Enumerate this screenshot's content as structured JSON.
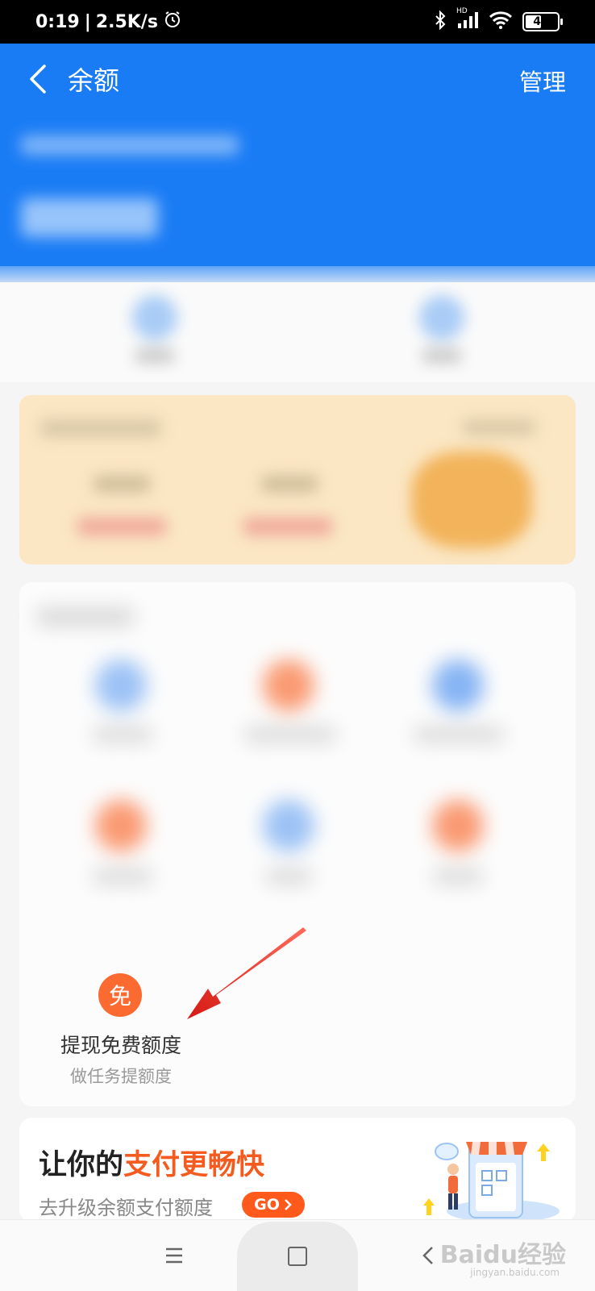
{
  "status_bar": {
    "time": "0:19",
    "separator": "|",
    "speed": "2.5K/s",
    "network_label": "HD",
    "battery": "44"
  },
  "nav": {
    "back_icon": "chevron-left-icon",
    "title": "余额",
    "manage_label": "管理"
  },
  "colors": {
    "header_blue": "#1a7cf5",
    "accent_orange": "#f55a1f",
    "go_orange": "#ff5a1c",
    "arrow_red": "#e8251f"
  },
  "free_quota": {
    "icon_char": "免",
    "title": "提现免费额度",
    "subtitle": "做任务提额度"
  },
  "banner": {
    "title_part1": "让你的",
    "title_part2": "支付更畅快",
    "subtitle": "去升级余额支付额度",
    "go_label": "GO"
  },
  "bottom_nav": {
    "menu_icon": "menu-icon",
    "home_icon": "home-square-icon",
    "back_icon": "back-triangle-icon",
    "watermark": "Baidu经验",
    "watermark_sub": "jingyan.baidu.com"
  }
}
